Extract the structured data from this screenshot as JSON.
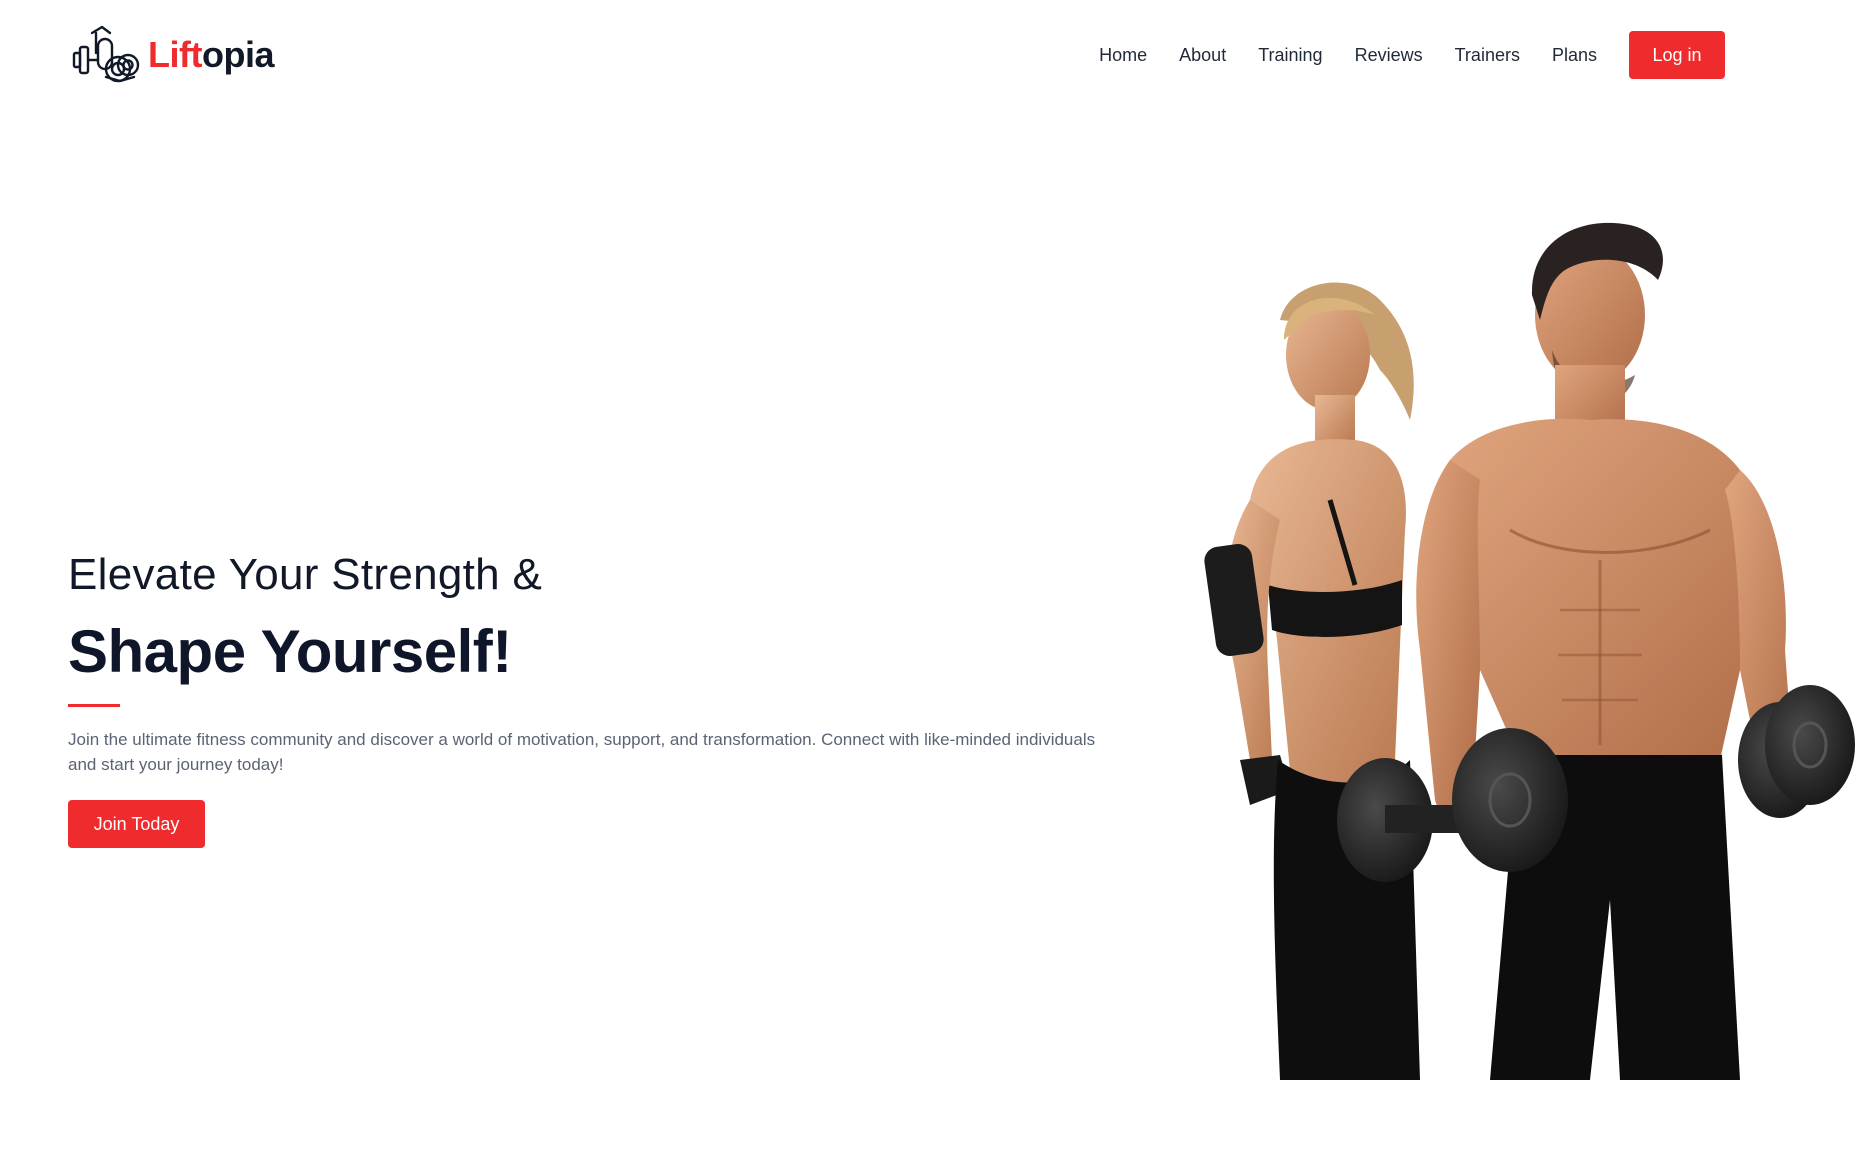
{
  "brand": {
    "accent": "Lift",
    "rest": "opia",
    "accent_color": "#ef2b2d",
    "icon": "dumbbell-logo-icon"
  },
  "nav": {
    "items": [
      {
        "label": "Home"
      },
      {
        "label": "About"
      },
      {
        "label": "Training"
      },
      {
        "label": "Reviews"
      },
      {
        "label": "Trainers"
      },
      {
        "label": "Plans"
      }
    ],
    "login_label": "Log in"
  },
  "hero": {
    "line1": "Elevate Your Strength &",
    "line2": "Shape Yourself!",
    "description": "Join the ultimate fitness community and discover a world of motivation, support, and transformation. Connect with like-minded individuals and start your journey today!",
    "cta_label": "Join Today",
    "image": "athletes-with-dumbbells-image"
  },
  "colors": {
    "accent": "#ef2b2d",
    "heading": "#0f1629",
    "body_text": "#5b6374"
  }
}
